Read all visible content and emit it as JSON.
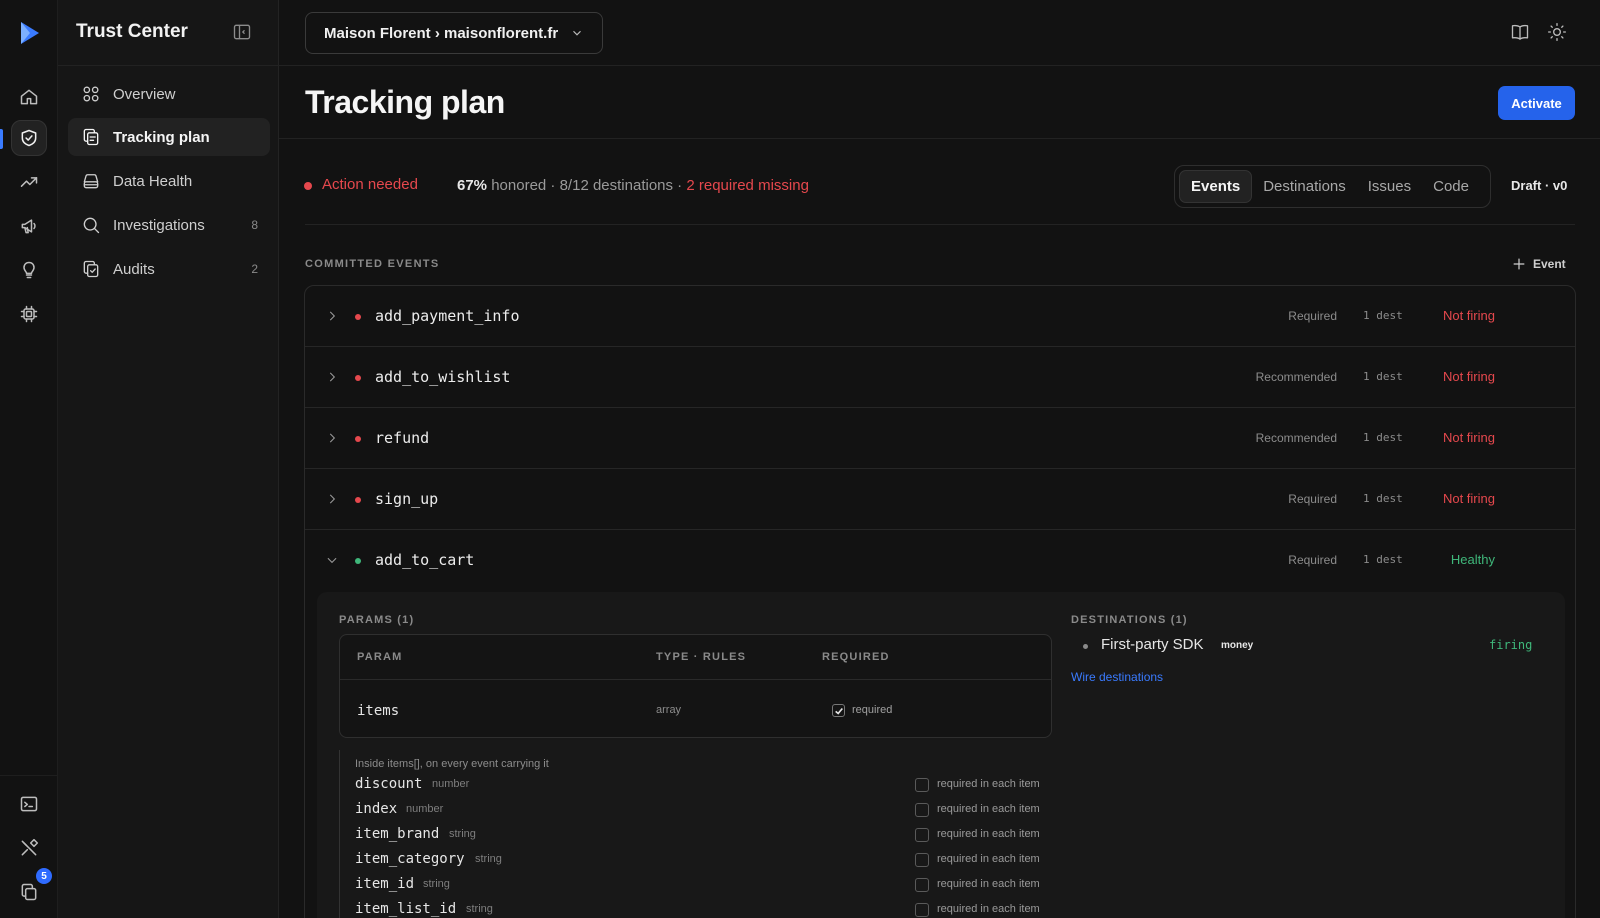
{
  "app": {
    "title": "Trust Center"
  },
  "rail": {
    "items": [
      "home-icon",
      "shield-icon",
      "trending-icon",
      "megaphone-icon",
      "lightbulb-icon",
      "chip-icon"
    ],
    "bottom_items": [
      "terminal-icon",
      "tools-icon",
      "copy-icon"
    ],
    "badge_count": "5"
  },
  "sidebar": {
    "items": [
      {
        "label": "Overview",
        "icon": "grid-icon",
        "count": ""
      },
      {
        "label": "Tracking plan",
        "icon": "clipboard-icon",
        "count": ""
      },
      {
        "label": "Data Health",
        "icon": "database-icon",
        "count": ""
      },
      {
        "label": "Investigations",
        "icon": "search-icon",
        "count": "8"
      },
      {
        "label": "Audits",
        "icon": "audit-icon",
        "count": "2"
      }
    ]
  },
  "topbar": {
    "workspace": "Maison Florent › maisonflorent.fr"
  },
  "page": {
    "title": "Tracking plan",
    "activate_label": "Activate"
  },
  "status": {
    "label": "Action needed",
    "honored_pct": "67%",
    "honored_suffix": " honored",
    "separator": " · ",
    "destinations": "8/12 destinations",
    "missing": "2 required missing"
  },
  "tabs": [
    "Events",
    "Destinations",
    "Issues",
    "Code"
  ],
  "draft": "Draft · v0",
  "events": {
    "section_label": "COMMITTED EVENTS",
    "add_label": "Event",
    "rows": [
      {
        "name": "add_payment_info",
        "priority": "Required",
        "dest": "1 dest",
        "state": "Not firing",
        "status_color": "#e5484d",
        "expanded": false
      },
      {
        "name": "add_to_wishlist",
        "priority": "Recommended",
        "dest": "1 dest",
        "state": "Not firing",
        "status_color": "#e5484d",
        "expanded": false
      },
      {
        "name": "refund",
        "priority": "Recommended",
        "dest": "1 dest",
        "state": "Not firing",
        "status_color": "#e5484d",
        "expanded": false
      },
      {
        "name": "sign_up",
        "priority": "Required",
        "dest": "1 dest",
        "state": "Not firing",
        "status_color": "#e5484d",
        "expanded": false
      },
      {
        "name": "add_to_cart",
        "priority": "Required",
        "dest": "1 dest",
        "state": "Healthy",
        "status_color": "#3fb77a",
        "expanded": true
      }
    ]
  },
  "params": {
    "label": "PARAMS (1)",
    "headers": {
      "param": "PARAM",
      "type": "TYPE · RULES",
      "required": "REQUIRED"
    },
    "row": {
      "name": "items",
      "type": "array",
      "required_label": "required",
      "checked": true
    },
    "items_caption": "Inside items[], on every event carrying it",
    "item_required_label": "required in each item",
    "item_fields": [
      {
        "name": "discount",
        "type": "number"
      },
      {
        "name": "index",
        "type": "number"
      },
      {
        "name": "item_brand",
        "type": "string"
      },
      {
        "name": "item_category",
        "type": "string"
      },
      {
        "name": "item_id",
        "type": "string"
      },
      {
        "name": "item_list_id",
        "type": "string"
      }
    ]
  },
  "destinations": {
    "label": "DESTINATIONS (1)",
    "name": "First-party SDK",
    "tag": "money",
    "state": "firing",
    "wire_label": "Wire destinations"
  },
  "colors": {
    "accent": "#2563eb",
    "error": "#e5484d",
    "success": "#3fb77a",
    "link": "#3a7bff"
  }
}
